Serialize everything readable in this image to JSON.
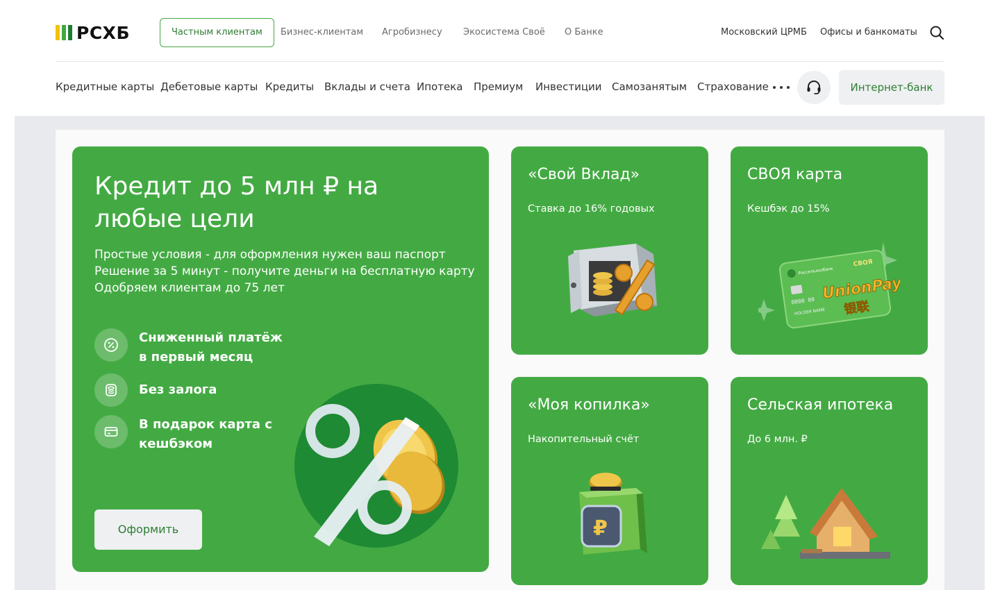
{
  "brand": {
    "name": "РСХБ"
  },
  "segments": [
    {
      "label": "Частным клиентам",
      "active": true
    },
    {
      "label": "Бизнес-клиентам"
    },
    {
      "label": "Агробизнесу"
    },
    {
      "label": "Экосистема Своё"
    },
    {
      "label": "О Банке"
    }
  ],
  "top_links": {
    "region": "Московский ЦРМБ",
    "offices": "Офисы и банкоматы"
  },
  "nav": {
    "items": [
      "Кредитные карты",
      "Дебетовые карты",
      "Кредиты",
      "Вклады и счета",
      "Ипотека",
      "Премиум",
      "Инвестиции",
      "Самозанятым",
      "Страхование"
    ],
    "internet_bank": "Интернет-банк"
  },
  "hero": {
    "title": "Кредит до 5 млн ₽ на любые цели",
    "lines": [
      "Простые условия - для оформления нужен ваш паспорт",
      "Решение за 5 минут - получите деньги на бесплатную карту",
      "Одобряем клиентам до 75 лет"
    ],
    "features": [
      {
        "text": "Сниженный платёж в первый месяц",
        "icon": "percent-badge-icon"
      },
      {
        "text": "Без залога",
        "icon": "coins-icon"
      },
      {
        "text": "В подарок карта с кешбэком",
        "icon": "card-icon"
      }
    ],
    "cta": "Оформить"
  },
  "cards": [
    {
      "title": "«Свой Вклад»",
      "subtitle": "Ставка до 16% годовых",
      "art": "safe-percent-illustration"
    },
    {
      "title": "СВОЯ карта",
      "subtitle": "Кешбэк до 15%",
      "art": "unionpay-card-illustration",
      "card_text": {
        "bank": "Россельхозбанк",
        "brand": "СВОЯ",
        "network": "UnionPay",
        "network_cn": "银联",
        "number": "0000 00",
        "holder": "HOLDER NAME"
      }
    },
    {
      "title": "«Моя копилка»",
      "subtitle": "Накопительный счёт",
      "art": "piggy-box-illustration"
    },
    {
      "title": "Сельская ипотека",
      "subtitle": "До 6 млн. ₽",
      "art": "cabin-illustration"
    }
  ],
  "colors": {
    "brand_green": "#43aa43",
    "dark_green": "#2f7d32",
    "logo_yellow": "#f2c200"
  }
}
